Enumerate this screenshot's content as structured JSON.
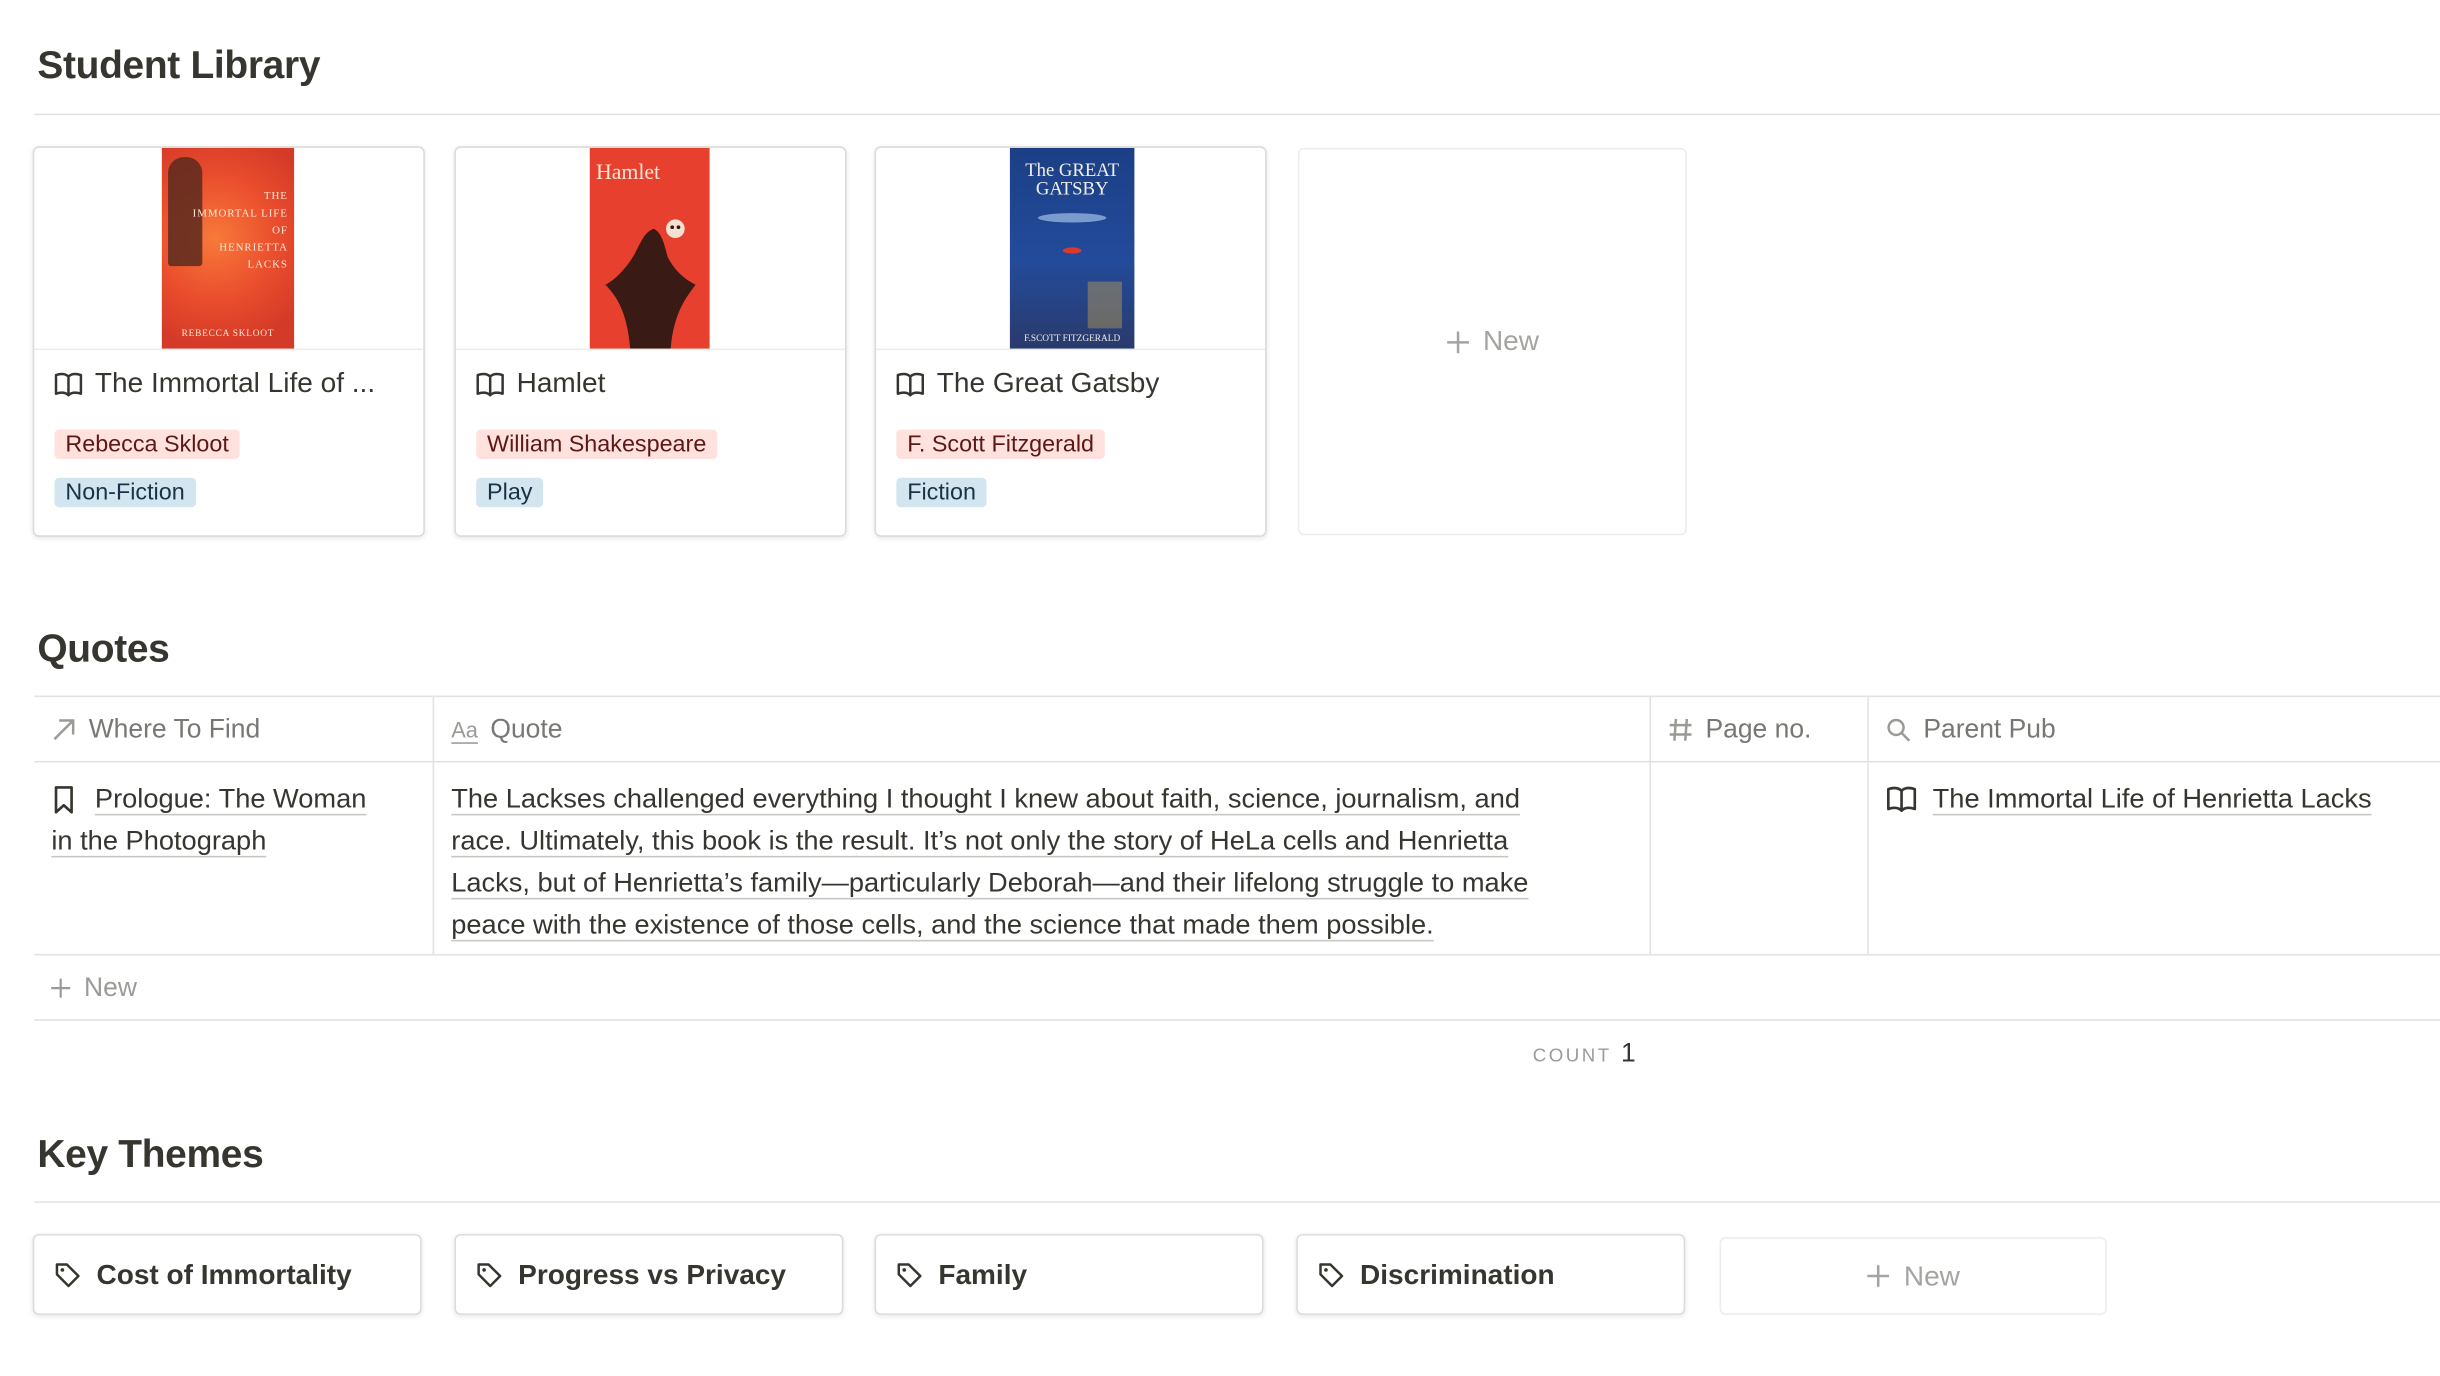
{
  "library": {
    "title": "Student Library",
    "books": [
      {
        "title": "The Immortal Life of ...",
        "author": "Rebecca Skloot",
        "genre": "Non-Fiction",
        "cover_lines": [
          "THE",
          "IMMORTAL LIFE",
          "OF",
          "HENRIETTA",
          "LACKS"
        ],
        "cover_author": "REBECCA SKLOOT"
      },
      {
        "title": "Hamlet",
        "author": "William Shakespeare",
        "genre": "Play",
        "cover_lines": [
          "Hamlet"
        ]
      },
      {
        "title": "The Great Gatsby",
        "author": "F. Scott Fitzgerald",
        "genre": "Fiction",
        "cover_lines": [
          "The GREAT",
          "GATSBY"
        ],
        "cover_author": "F.SCOTT FITZGERALD"
      }
    ],
    "new_label": "New"
  },
  "quotes": {
    "title": "Quotes",
    "columns": [
      "Where To Find",
      "Quote",
      "Page no.",
      "Parent Pub"
    ],
    "rows": [
      {
        "where_line1": "Prologue: The Woman",
        "where_line2": "in the Photograph",
        "quote_lines": [
          "The Lackses challenged everything I thought I knew about faith, science, journalism, and",
          "race. Ultimately, this book is the result. It’s not only the story of HeLa cells and Henrietta",
          "Lacks, but of Henrietta’s family—particularly Deborah—and their lifelong struggle to make",
          "peace with the existence of those cells, and the science that made them possible."
        ],
        "page_no": "",
        "parent_pub": "The Immortal Life of Henrietta Lacks"
      }
    ],
    "new_label": "New",
    "count_label": "COUNT",
    "count_value": "1"
  },
  "themes": {
    "title": "Key Themes",
    "items": [
      "Cost of Immortality",
      "Progress vs Privacy",
      "Family",
      "Discrimination"
    ],
    "new_label": "New"
  }
}
